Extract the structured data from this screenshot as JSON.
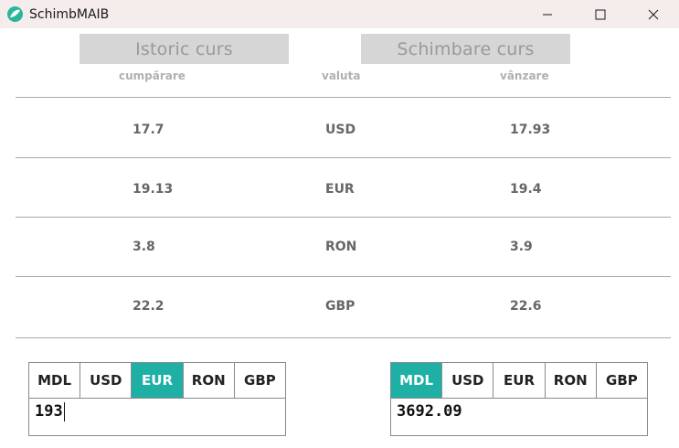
{
  "window": {
    "title": "SchimbMAIB",
    "icon": "app-leaf-icon",
    "controls": [
      "minimize-icon",
      "maximize-icon",
      "close-icon"
    ]
  },
  "modes": {
    "history_label": "Istoric curs",
    "exchange_label": "Schimbare curs"
  },
  "rates": {
    "headers": {
      "buy": "cumpărare",
      "currency": "valuta",
      "sell": "vânzare"
    },
    "rows": [
      {
        "buy": "17.7",
        "currency": "USD",
        "sell": "17.93"
      },
      {
        "buy": "19.13",
        "currency": "EUR",
        "sell": "19.4"
      },
      {
        "buy": "3.8",
        "currency": "RON",
        "sell": "3.9"
      },
      {
        "buy": "22.2",
        "currency": "GBP",
        "sell": "22.6"
      }
    ]
  },
  "converter": {
    "from": {
      "currencies": [
        "MDL",
        "USD",
        "EUR",
        "RON",
        "GBP"
      ],
      "selected": "EUR",
      "amount": "193"
    },
    "to": {
      "currencies": [
        "MDL",
        "USD",
        "EUR",
        "RON",
        "GBP"
      ],
      "selected": "MDL",
      "amount": "3692.09"
    }
  },
  "colors": {
    "accent": "#1fb0a5",
    "titlebar": "#f5ecec",
    "mode_button_bg": "#d6d6d6"
  }
}
